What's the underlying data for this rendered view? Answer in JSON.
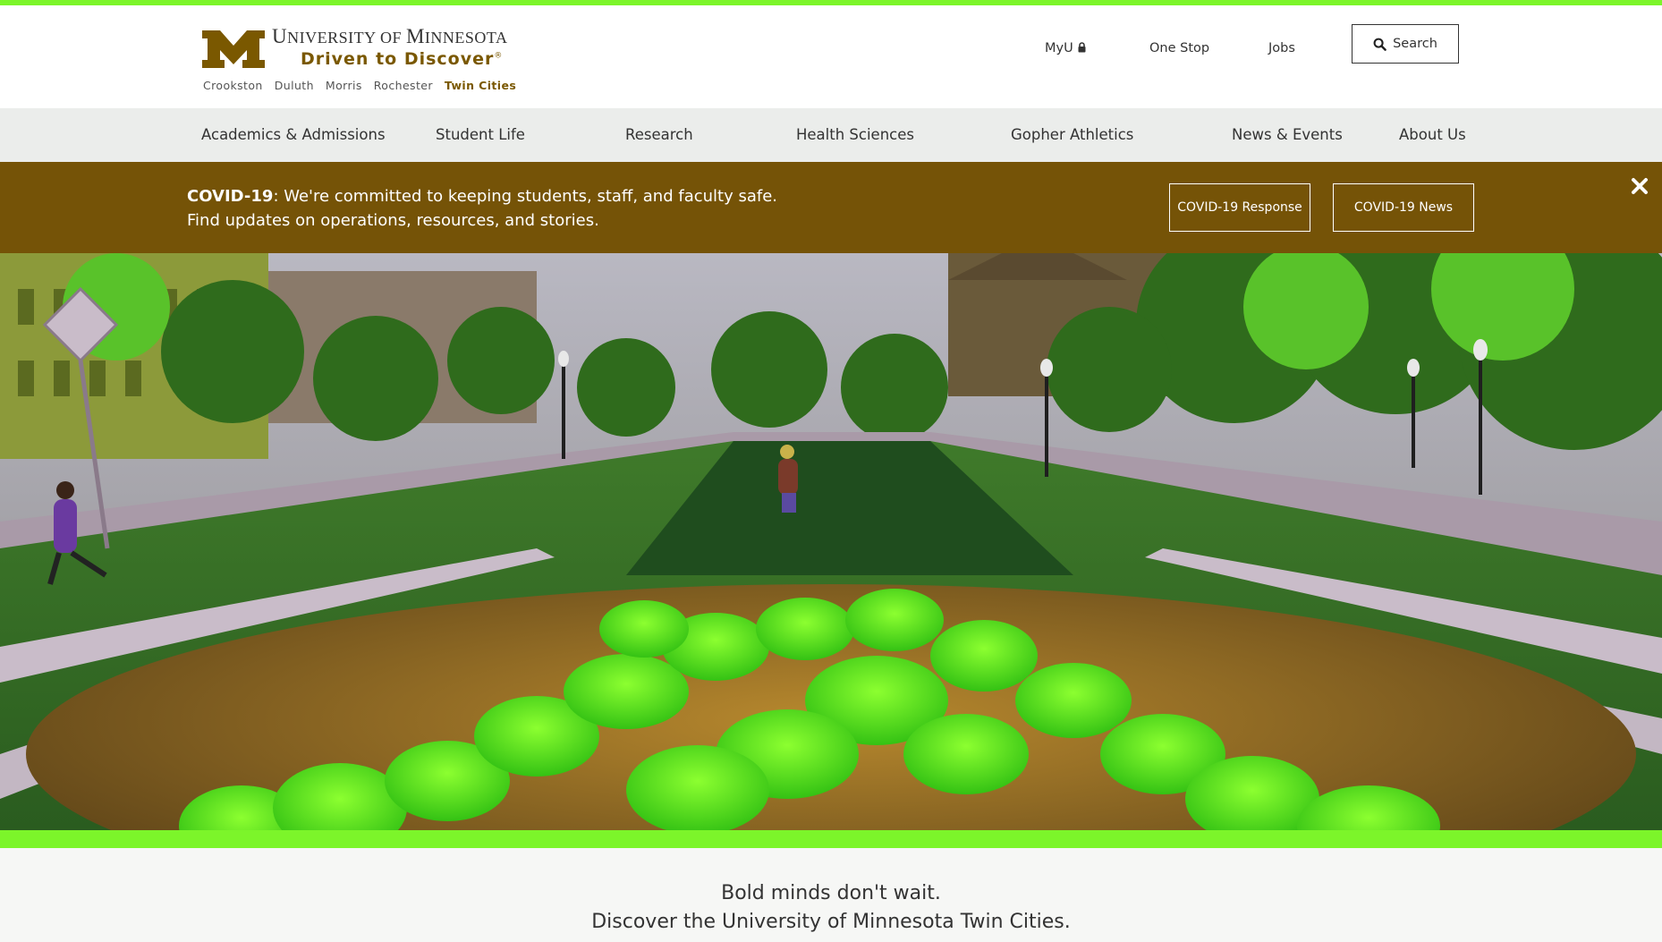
{
  "colors": {
    "accent_green": "#7cf52a",
    "maroon_gold": "#7a5800",
    "alert_bg": "#755307",
    "nav_bg": "#ebedeb"
  },
  "header": {
    "logo": {
      "line1_first": "U",
      "line1_rest": "NIVERSITY OF ",
      "line1_m": "M",
      "line1_end": "INNESOTA",
      "line2": "Driven to Discover",
      "line2_mark": "®"
    },
    "campuses": [
      "Crookston",
      "Duluth",
      "Morris",
      "Rochester",
      "Twin Cities"
    ],
    "utility_links": {
      "myu": "MyU",
      "one_stop": "One Stop",
      "jobs": "Jobs"
    },
    "search_label": "Search"
  },
  "nav": {
    "items": [
      "Academics & Admissions",
      "Student Life",
      "Research",
      "Health Sciences",
      "Gopher Athletics",
      "News & Events",
      "About Us"
    ]
  },
  "alert": {
    "bold": "COVID-19",
    "line1_rest": ": We're committed to keeping students, staff, and faculty safe.",
    "line2": "Find updates on operations, resources, and stories.",
    "buttons": [
      "COVID-19 Response",
      "COVID-19 News"
    ]
  },
  "tagline": {
    "line1": "Bold minds don't wait.",
    "line2": "Discover the University of Minnesota Twin Cities."
  }
}
